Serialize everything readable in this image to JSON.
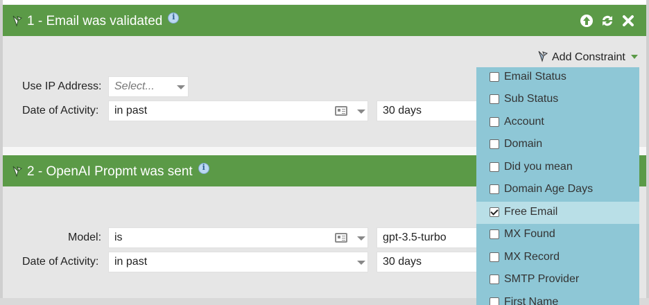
{
  "filters": [
    {
      "title": "1 - Email was validated",
      "rows": [
        {
          "label": "Use IP Address:",
          "value": "Select..."
        },
        {
          "label": "Date of Activity:",
          "value": "in past",
          "value2": "30 days"
        }
      ]
    },
    {
      "title": "2 - OpenAI Propmt was sent",
      "rows": [
        {
          "label": "Model:",
          "value": "is",
          "value2": "gpt-3.5-turbo"
        },
        {
          "label": "Date of Activity:",
          "value": "in past",
          "value2": "30 days"
        }
      ]
    }
  ],
  "add_constraint": {
    "label": "Add Constraint"
  },
  "constraint_menu": {
    "items": [
      {
        "label": "Email Status",
        "checked": false
      },
      {
        "label": "Sub Status",
        "checked": false
      },
      {
        "label": "Account",
        "checked": false
      },
      {
        "label": "Domain",
        "checked": false
      },
      {
        "label": "Did you mean",
        "checked": false
      },
      {
        "label": "Domain Age Days",
        "checked": false
      },
      {
        "label": "Free Email",
        "checked": true
      },
      {
        "label": "MX Found",
        "checked": false
      },
      {
        "label": "MX Record",
        "checked": false
      },
      {
        "label": "SMTP Provider",
        "checked": false
      },
      {
        "label": "First Name",
        "checked": false
      }
    ]
  },
  "colors": {
    "header_green": "#5b9a47",
    "menu_blue": "#8ec7d6",
    "menu_highlight": "#b9dfe7"
  },
  "icons": [
    "drag-handle-icon",
    "info-icon",
    "move-up-icon",
    "refresh-icon",
    "close-icon",
    "card-list-icon",
    "chevron-down-icon",
    "checkbox-icon"
  ]
}
